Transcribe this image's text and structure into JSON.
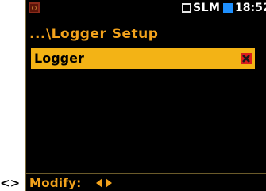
{
  "page_prefix": "<>",
  "status_bar": {
    "mode_label": "SLM",
    "time": "18:52",
    "icons": {
      "app": "device-app-icon",
      "mode": "mode-square-icon",
      "battery": "battery-icon"
    },
    "colors": {
      "battery": "#1e90ff"
    }
  },
  "title": "...\\Logger Setup",
  "menu": {
    "items": [
      {
        "label": "Logger",
        "checked": false,
        "checkbox_icon": "x-icon"
      }
    ]
  },
  "footer": {
    "hint_label": "Modify:",
    "icons": [
      "arrow-left-icon",
      "arrow-right-icon"
    ]
  },
  "colors": {
    "accent": "#f2a21c",
    "highlight": "#f3b315",
    "checkbox": "#d81e1e",
    "background": "#000000"
  }
}
